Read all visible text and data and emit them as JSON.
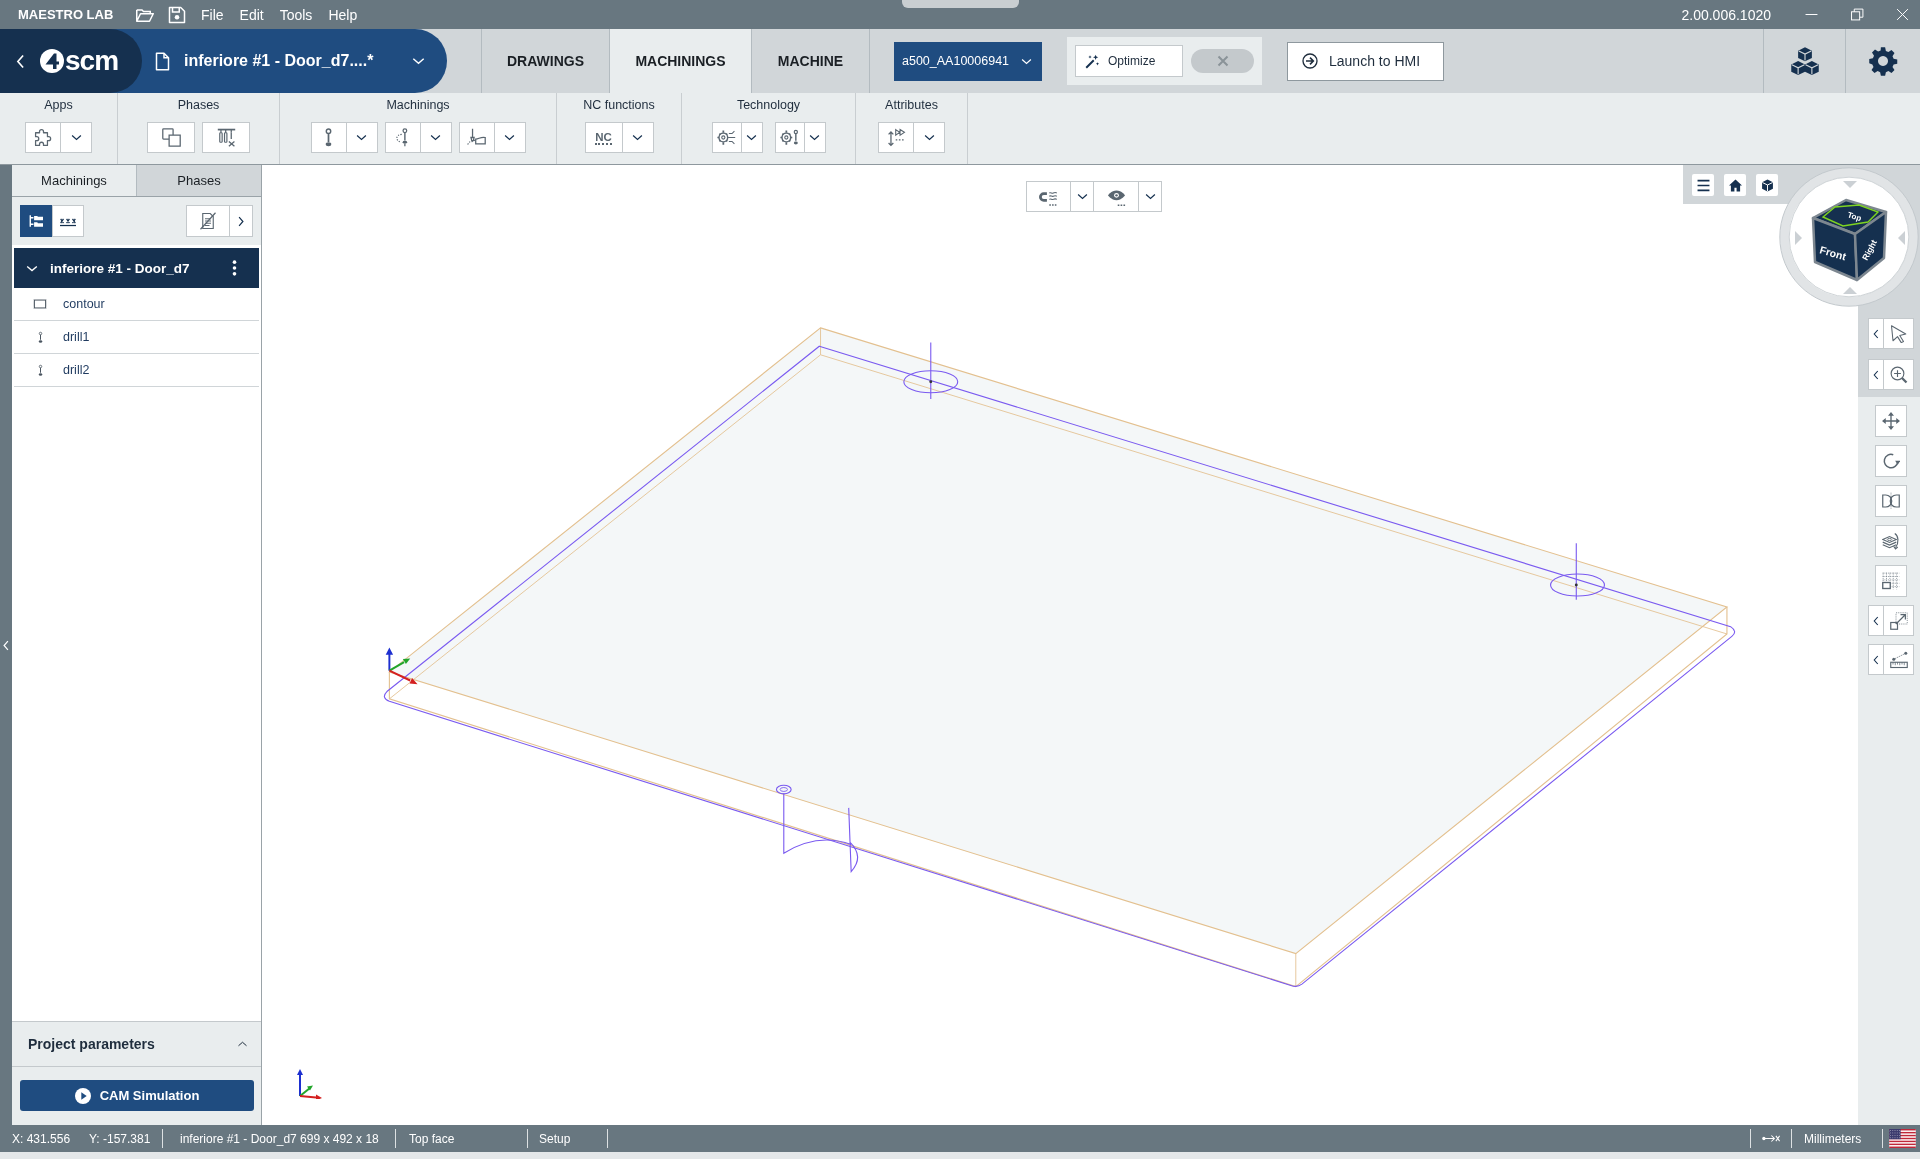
{
  "title_bar": {
    "app_name": "MAESTRO LAB",
    "menu": [
      "File",
      "Edit",
      "Tools",
      "Help"
    ],
    "version": "2.00.006.1020"
  },
  "header": {
    "logo_text": "scm",
    "document_title": "inferiore #1 - Door_d7....*",
    "tabs": [
      {
        "label": "DRAWINGS",
        "selected": false
      },
      {
        "label": "MACHININGS",
        "selected": true
      },
      {
        "label": "MACHINE",
        "selected": false
      }
    ],
    "machine_select": "a500_AA10006941",
    "optimize": {
      "label": "Optimize",
      "on": false
    },
    "launch_button": "Launch to HMI"
  },
  "ribbon": {
    "groups": [
      {
        "label": "Apps",
        "buttons": [
          {
            "kind": "split"
          }
        ]
      },
      {
        "label": "Phases",
        "buttons": [
          {
            "kind": "plain"
          },
          {
            "kind": "plain"
          }
        ]
      },
      {
        "label": "Machinings",
        "buttons": [
          {
            "kind": "split"
          },
          {
            "kind": "split"
          },
          {
            "kind": "split"
          }
        ]
      },
      {
        "label": "NC functions",
        "buttons": [
          {
            "kind": "split",
            "text": "NC"
          }
        ]
      },
      {
        "label": "Technology",
        "buttons": [
          {
            "kind": "split"
          },
          {
            "kind": "split"
          }
        ]
      },
      {
        "label": "Attributes",
        "buttons": [
          {
            "kind": "split"
          }
        ]
      }
    ]
  },
  "left_panel": {
    "tabs": [
      {
        "label": "Machinings",
        "selected": true
      },
      {
        "label": "Phases",
        "selected": false
      }
    ],
    "view_modes": [
      {
        "selected": true
      },
      {
        "selected": false
      }
    ],
    "tree": {
      "label": "inferiore #1 - Door_d7",
      "expanded": true,
      "children": [
        {
          "label": "contour",
          "kind": "contour"
        },
        {
          "label": "drill1",
          "kind": "drill"
        },
        {
          "label": "drill2",
          "kind": "drill"
        }
      ]
    },
    "project_parameters": {
      "label": "Project parameters",
      "expanded": false
    },
    "cam_button": "CAM Simulation"
  },
  "viewport": {
    "view_cube": {
      "faces": [
        "Top",
        "Front",
        "Right"
      ]
    }
  },
  "status_bar": {
    "x": "X: 431.556",
    "y": "Y: -157.381",
    "part": "inferiore #1 - Door_d7 699 x 492 x 18",
    "face": "Top face",
    "phase": "Setup",
    "units": "Millimeters"
  }
}
